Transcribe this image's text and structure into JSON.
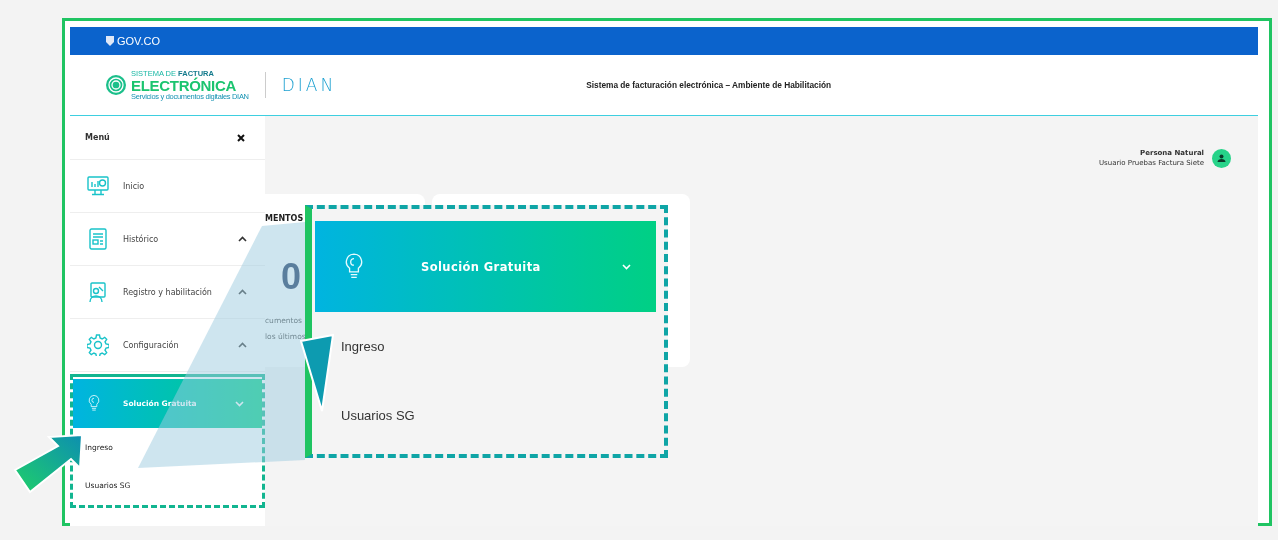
{
  "gov_bar": {
    "label": "GOV.CO"
  },
  "header": {
    "logo": {
      "line1": "SISTEMA DE **FACTURA**",
      "line2": "ELECTRÓNICA",
      "line3": "Servicios y documentos digitales DIAN"
    },
    "dian": "DIAN",
    "title": "Sistema de facturación electrónica – Ambiente de Habilitación"
  },
  "user": {
    "role": "Persona Natural",
    "name": "Usuario Pruebas Factura Siete"
  },
  "menu": {
    "title": "Menú",
    "items": [
      {
        "label": "Inicio",
        "expandable": false
      },
      {
        "label": "Histórico",
        "expandable": true
      },
      {
        "label": "Registro y habilitación",
        "expandable": true
      },
      {
        "label": "Configuración",
        "expandable": true
      }
    ],
    "submenu": {
      "label": "Solución Gratuita",
      "expanded": true,
      "items": [
        {
          "label": "Ingreso"
        },
        {
          "label": "Usuarios SG"
        }
      ]
    }
  },
  "cards": [
    {
      "heading": "MENTOS",
      "value": "0",
      "lines": [
        "cumentos",
        "los últimos"
      ]
    }
  ],
  "callout": {
    "label": "Solución Gratuita",
    "expanded": true,
    "items": [
      {
        "label": "Ingreso"
      },
      {
        "label": "Usuarios SG"
      }
    ]
  }
}
